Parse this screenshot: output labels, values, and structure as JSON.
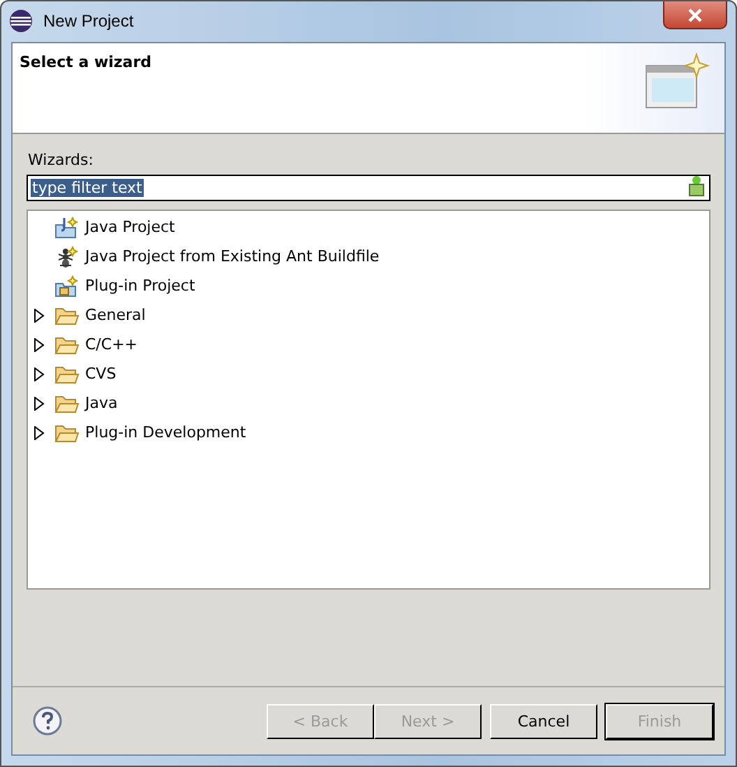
{
  "window": {
    "title": "New Project"
  },
  "header": {
    "title": "Select a wizard"
  },
  "wizards_label": "Wizards:",
  "filter": {
    "value": "type filter text",
    "selected": true
  },
  "tree": [
    {
      "kind": "java",
      "label": "Java Project"
    },
    {
      "kind": "ant",
      "label": "Java Project from Existing Ant Buildfile"
    },
    {
      "kind": "plugin",
      "label": "Plug-in Project"
    },
    {
      "kind": "folder",
      "label": "General",
      "expanded": false
    },
    {
      "kind": "folder",
      "label": "C/C++",
      "expanded": false
    },
    {
      "kind": "folder",
      "label": "CVS",
      "expanded": false
    },
    {
      "kind": "folder",
      "label": "Java",
      "expanded": false
    },
    {
      "kind": "folder",
      "label": "Plug-in Development",
      "expanded": false
    }
  ],
  "buttons": [
    {
      "label": "< Back",
      "disabled": true,
      "default": false
    },
    {
      "label": "Next >",
      "disabled": true,
      "default": false
    },
    {
      "label": "Cancel",
      "disabled": false,
      "default": false
    },
    {
      "label": "Finish",
      "disabled": true,
      "default": true
    }
  ]
}
